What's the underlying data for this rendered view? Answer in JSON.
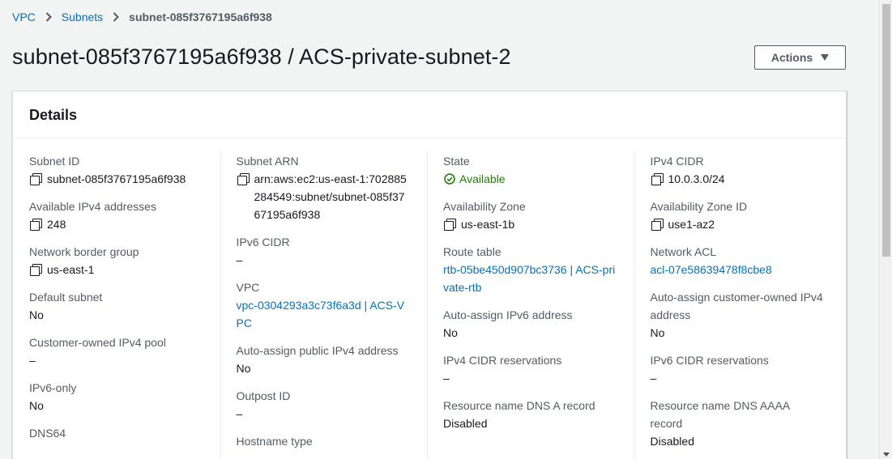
{
  "breadcrumb": {
    "items": [
      "VPC",
      "Subnets"
    ],
    "current": "subnet-085f3767195a6f938"
  },
  "page": {
    "title": "subnet-085f3767195a6f938 / ACS-private-subnet-2",
    "actions_label": "Actions"
  },
  "details": {
    "heading": "Details",
    "col1": [
      {
        "label": "Subnet ID",
        "value": "subnet-085f3767195a6f938"
      },
      {
        "label": "Available IPv4 addresses",
        "value": "248"
      },
      {
        "label": "Network border group",
        "value": "us-east-1"
      },
      {
        "label": "Default subnet",
        "value": "No"
      },
      {
        "label": "Customer-owned IPv4 pool",
        "value": "–"
      },
      {
        "label": "IPv6-only",
        "value": "No"
      },
      {
        "label": "DNS64",
        "value": ""
      }
    ],
    "col2": [
      {
        "label": "Subnet ARN",
        "value": "arn:aws:ec2:us-east-1:702885284549:subnet/subnet-085f3767195a6f938"
      },
      {
        "label": "IPv6 CIDR",
        "value": "–"
      },
      {
        "label": "VPC",
        "value": "vpc-0304293a3c73f6a3d | ACS-VPC"
      },
      {
        "label": "Auto-assign public IPv4 address",
        "value": "No"
      },
      {
        "label": "Outpost ID",
        "value": "–"
      },
      {
        "label": "Hostname type",
        "value": ""
      }
    ],
    "col3": [
      {
        "label": "State",
        "value": "Available"
      },
      {
        "label": "Availability Zone",
        "value": "us-east-1b"
      },
      {
        "label": "Route table",
        "value": "rtb-05be450d907bc3736 | ACS-private-rtb"
      },
      {
        "label": "Auto-assign IPv6 address",
        "value": "No"
      },
      {
        "label": "IPv4 CIDR reservations",
        "value": "–"
      },
      {
        "label": "Resource name DNS A record",
        "value": "Disabled"
      }
    ],
    "col4": [
      {
        "label": "IPv4 CIDR",
        "value": "10.0.3.0/24"
      },
      {
        "label": "Availability Zone ID",
        "value": "use1-az2"
      },
      {
        "label": "Network ACL",
        "value": "acl-07e58639478f8cbe8"
      },
      {
        "label": "Auto-assign customer-owned IPv4 address",
        "value": "No"
      },
      {
        "label": "IPv6 CIDR reservations",
        "value": "–"
      },
      {
        "label": "Resource name DNS AAAA record",
        "value": "Disabled"
      }
    ]
  },
  "colors": {
    "link": "#0073bb",
    "success": "#1d8102",
    "text": "#16191f",
    "label": "#545b64"
  }
}
